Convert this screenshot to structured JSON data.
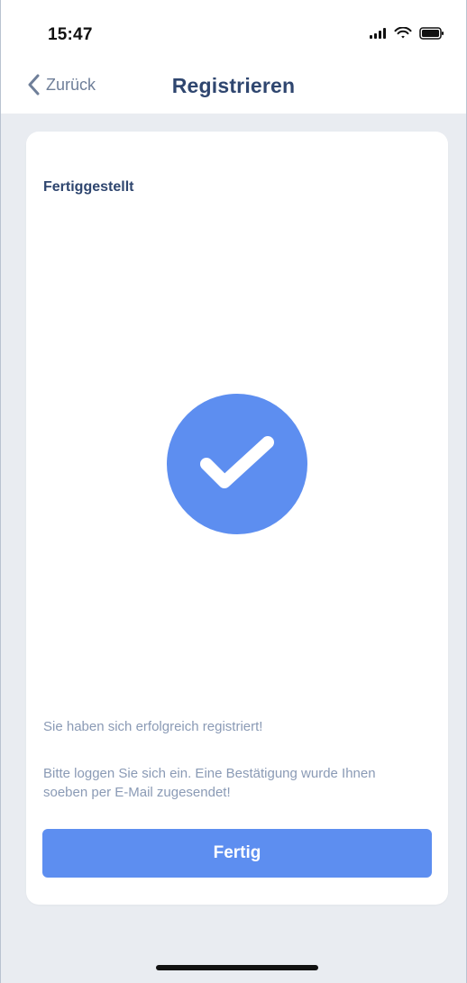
{
  "status_bar": {
    "time": "15:47"
  },
  "nav": {
    "back_label": "Zurück",
    "title": "Registrieren"
  },
  "card": {
    "heading": "Fertiggestellt",
    "success_message": "Sie haben sich erfolgreich registriert!",
    "instructions": "Bitte loggen Sie sich ein. Eine Bestätigung wurde Ihnen soeben per E-Mail zugesendet!",
    "button_label": "Fertig"
  },
  "icons": {
    "status": [
      "signal-icon",
      "wifi-icon",
      "battery-icon"
    ],
    "back": "chevron-left-icon",
    "success": "checkmark-icon"
  },
  "colors": {
    "accent": "#5d8ef0",
    "title": "#2f466f",
    "muted_text": "#8a9ab5",
    "background": "#e9ecf1"
  }
}
